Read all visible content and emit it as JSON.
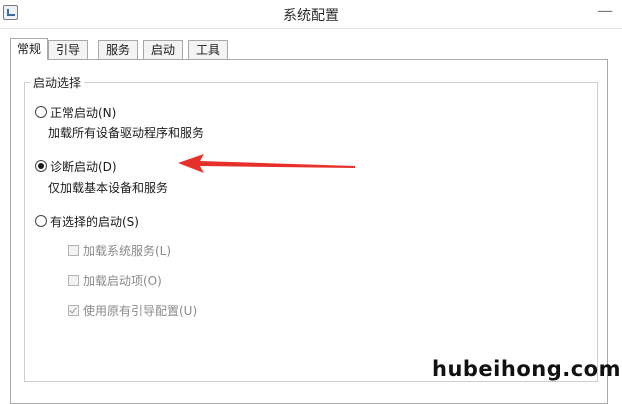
{
  "window": {
    "title": "系统配置",
    "close_glyph": "—",
    "icon": "msconfig-app-icon"
  },
  "tabs": [
    {
      "label": "常规",
      "active": true
    },
    {
      "label": "引导",
      "active": false
    },
    {
      "label": "服务",
      "active": false
    },
    {
      "label": "启动",
      "active": false
    },
    {
      "label": "工具",
      "active": false
    }
  ],
  "startup_selection": {
    "legend": "启动选择",
    "options": [
      {
        "label": "正常启动(N)",
        "description": "加载所有设备驱动程序和服务",
        "checked": false
      },
      {
        "label": "诊断启动(D)",
        "description": "仅加载基本设备和服务",
        "checked": true
      },
      {
        "label": "有选择的启动(S)",
        "description": "",
        "checked": false
      }
    ],
    "selective_items": [
      {
        "label": "加载系统服务(L)",
        "checked": false,
        "enabled": false
      },
      {
        "label": "加载启动项(O)",
        "checked": false,
        "enabled": false
      },
      {
        "label": "使用原有引导配置(U)",
        "checked": true,
        "enabled": false
      }
    ]
  },
  "annotation": {
    "arrow_color": "#e8302a",
    "points_to": "诊断启动(D)"
  },
  "watermark": "hubeihong.com"
}
